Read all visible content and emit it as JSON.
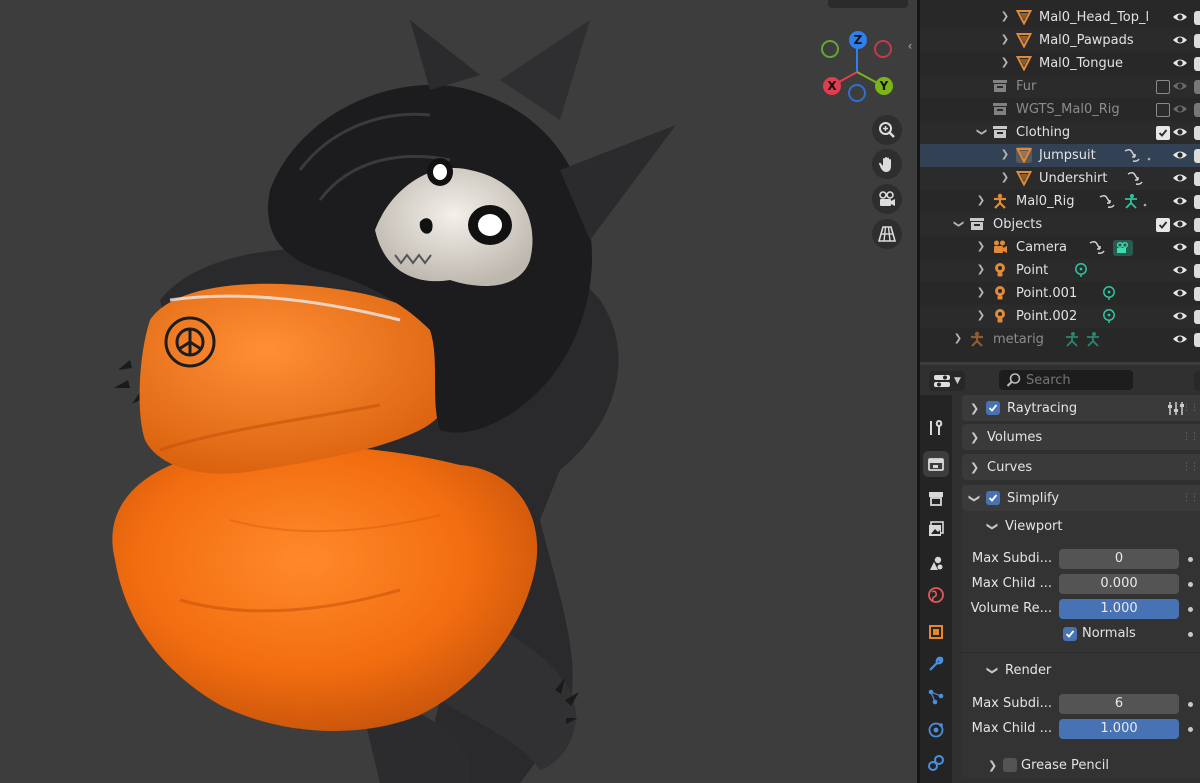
{
  "viewport": {
    "gizmo": {
      "axis_x": "X",
      "axis_y": "Y",
      "axis_z": "Z",
      "color_x": "#e23c4f",
      "color_y": "#7cb51a",
      "color_z": "#2f80ed"
    },
    "nav_tools": [
      "zoom-icon",
      "hand-pan-icon",
      "camera-view-icon",
      "ortho-grid-icon"
    ]
  },
  "outliner": {
    "rows": [
      {
        "label": "Mal0_Head_Top_l",
        "icon": "mesh-icon",
        "checkbox": null,
        "dim": false
      },
      {
        "label": "Mal0_Pawpads",
        "icon": "mesh-icon",
        "checkbox": null,
        "dim": false
      },
      {
        "label": "Mal0_Tongue",
        "icon": "mesh-icon",
        "checkbox": null,
        "dim": false
      },
      {
        "label": "Fur",
        "icon": "collection-icon",
        "checkbox": false,
        "dim": true
      },
      {
        "label": "WGTS_Mal0_Rig",
        "icon": "collection-icon",
        "checkbox": false,
        "dim": true
      },
      {
        "label": "Clothing",
        "icon": "collection-icon",
        "checkbox": true,
        "dim": false
      },
      {
        "label": "Jumpsuit",
        "icon": "mesh-icon",
        "checkbox": null,
        "dim": false
      },
      {
        "label": "Undershirt",
        "icon": "mesh-icon",
        "checkbox": null,
        "dim": false
      },
      {
        "label": "Mal0_Rig",
        "icon": "armature-icon",
        "checkbox": null,
        "dim": false
      },
      {
        "label": "Objects",
        "icon": "collection-icon",
        "checkbox": true,
        "dim": false
      },
      {
        "label": "Camera",
        "icon": "camera-object-icon",
        "checkbox": null,
        "dim": false
      },
      {
        "label": "Point",
        "icon": "light-icon",
        "checkbox": null,
        "dim": false
      },
      {
        "label": "Point.001",
        "icon": "light-icon",
        "checkbox": null,
        "dim": false
      },
      {
        "label": "Point.002",
        "icon": "light-icon",
        "checkbox": null,
        "dim": false
      },
      {
        "label": "metarig",
        "icon": "armature-icon",
        "checkbox": null,
        "dim": true
      }
    ]
  },
  "properties": {
    "search_placeholder": "Search",
    "panels": {
      "raytracing": "Raytracing",
      "volumes": "Volumes",
      "curves": "Curves",
      "simplify": "Simplify",
      "viewport_sub": "Viewport",
      "render_sub": "Render",
      "grease_pencil": "Grease Pencil"
    },
    "viewport_fields": [
      {
        "label": "Max Subdi...",
        "value": "0"
      },
      {
        "label": "Max Child ...",
        "value": "0.000"
      },
      {
        "label": "Volume Re...",
        "value": "1.000"
      }
    ],
    "normals_label": "Normals",
    "render_fields": [
      {
        "label": "Max Subdi...",
        "value": "6"
      },
      {
        "label": "Max Child ...",
        "value": "1.000"
      }
    ],
    "tabs": [
      "tool-icon",
      "render-icon",
      "output-icon",
      "view-layer-icon",
      "scene-icon",
      "world-icon",
      "object-icon",
      "modifier-icon",
      "particles-icon",
      "physics-icon",
      "constraints-icon"
    ],
    "accent": "#4772b3"
  }
}
